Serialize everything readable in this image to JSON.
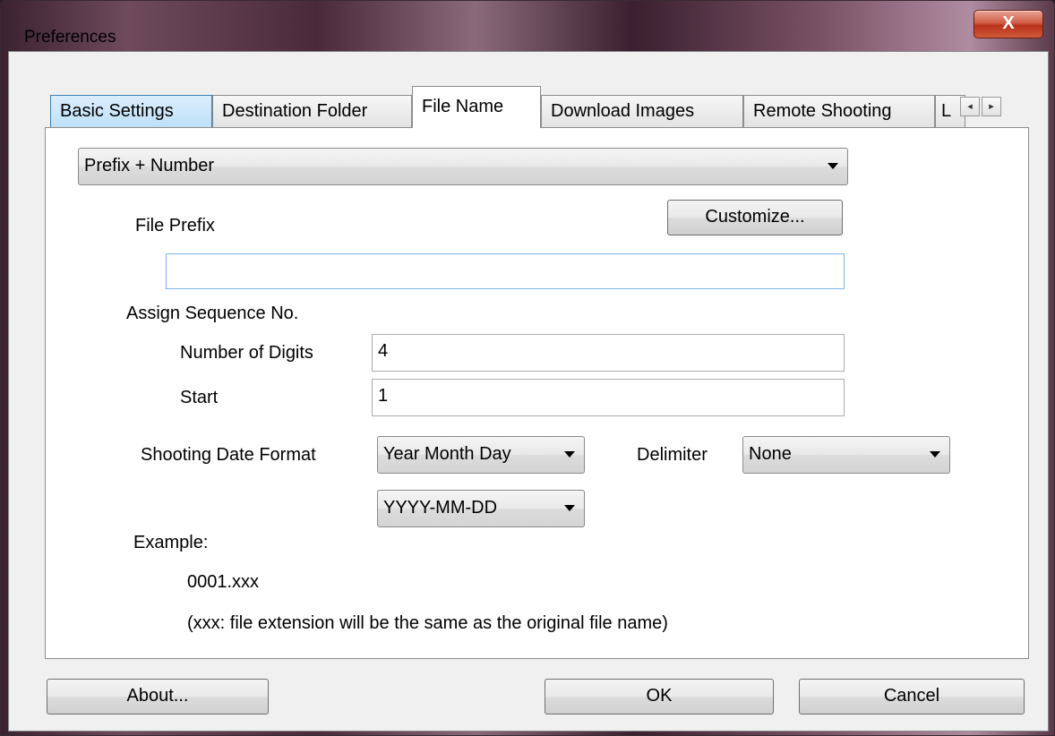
{
  "window": {
    "title": "Preferences",
    "close_glyph": "X"
  },
  "tabs": [
    {
      "label": "Basic Settings"
    },
    {
      "label": "Destination Folder"
    },
    {
      "label": "File Name"
    },
    {
      "label": "Download Images"
    },
    {
      "label": "Remote Shooting"
    },
    {
      "label": "L"
    }
  ],
  "tab_scroll": {
    "left": "◂",
    "right": "▸"
  },
  "file_name": {
    "format_select": "Prefix + Number",
    "file_prefix_label": "File Prefix",
    "customize_button": "Customize...",
    "file_prefix_value": "",
    "assign_sequence_label": "Assign Sequence No.",
    "number_of_digits_label": "Number of Digits",
    "number_of_digits_value": "4",
    "start_label": "Start",
    "start_value": "1",
    "shooting_date_format_label": "Shooting Date Format",
    "date_order_select": "Year Month Day",
    "delimiter_label": "Delimiter",
    "delimiter_select": "None",
    "date_pattern_select": "YYYY-MM-DD",
    "example_label": "Example:",
    "example_value": "0001.xxx",
    "example_note": "(xxx: file extension will be the same as the original file name)"
  },
  "footer": {
    "about_button": "About...",
    "ok_button": "OK",
    "cancel_button": "Cancel"
  }
}
